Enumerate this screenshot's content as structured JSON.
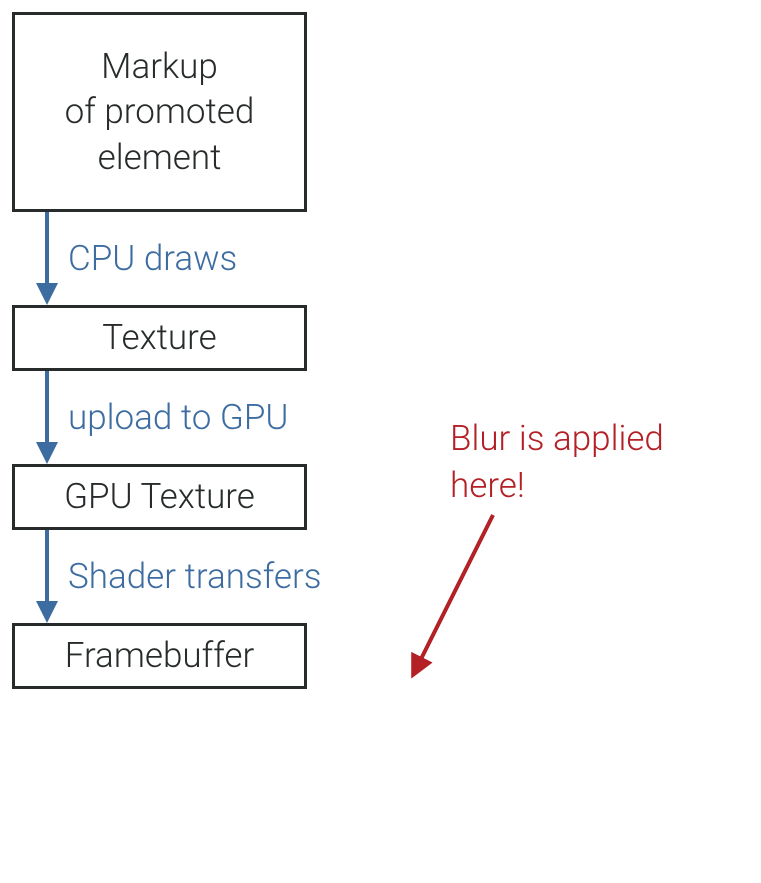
{
  "boxes": {
    "markup": "Markup\nof promoted\nelement",
    "texture": "Texture",
    "gpu_texture": "GPU Texture",
    "framebuffer": "Framebuffer"
  },
  "arrows": {
    "cpu_draws": "CPU draws",
    "upload_gpu": "upload to GPU",
    "shader_transfers": "Shader transfers"
  },
  "annotation": {
    "text": "Blur is applied\nhere!"
  }
}
